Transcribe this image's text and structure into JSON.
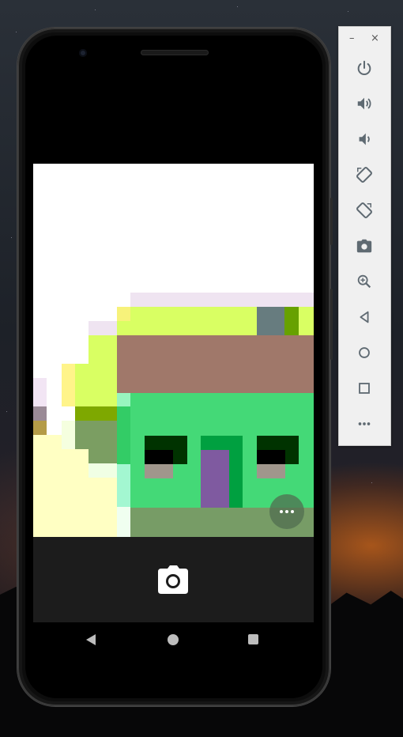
{
  "emulator_panel": {
    "minimize_label": "–",
    "close_label": "×",
    "tools": [
      {
        "icon": "power-icon"
      },
      {
        "icon": "volume-up-icon"
      },
      {
        "icon": "volume-down-icon"
      },
      {
        "icon": "rotate-left-icon"
      },
      {
        "icon": "rotate-right-icon"
      },
      {
        "icon": "screenshot-icon"
      },
      {
        "icon": "zoom-icon"
      },
      {
        "icon": "back-icon"
      },
      {
        "icon": "home-icon"
      },
      {
        "icon": "overview-icon"
      },
      {
        "icon": "more-icon"
      }
    ]
  },
  "camera_app": {
    "shutter_icon": "camera-icon",
    "options_icon": "more-horizontal-icon"
  },
  "system_nav": {
    "buttons": [
      "back",
      "home",
      "recents"
    ]
  },
  "colors": {
    "preview_background": "#ffffff",
    "camera_bar": "#1c1c1c",
    "house_green": "#44d977",
    "roof_brown": "#a0786a",
    "door_purple": "#7f5aa0",
    "panel_background": "#f0f0f0"
  }
}
